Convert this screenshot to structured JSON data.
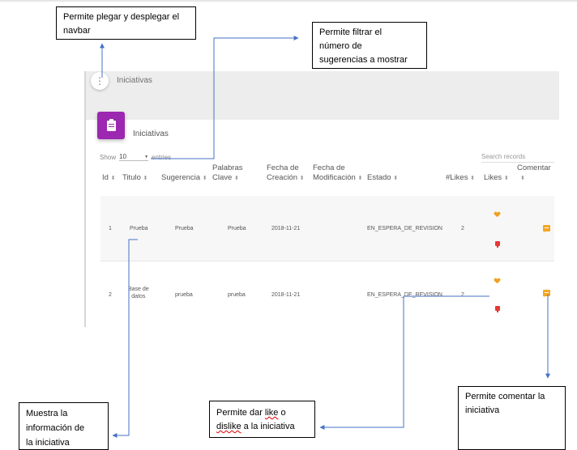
{
  "app": {
    "navbar": {
      "title": "Iniciativas",
      "toggle_glyph": "⋮"
    },
    "card": {
      "title": "Iniciativas",
      "show_label": "Show",
      "entries_value": "10",
      "entries_label": "entries",
      "search_placeholder": "Search records"
    },
    "table": {
      "headers": [
        {
          "line1": "Id",
          "line2": ""
        },
        {
          "line1": "Titulo",
          "line2": ""
        },
        {
          "line1": "Sugerencia",
          "line2": ""
        },
        {
          "line1": "Palabras",
          "line2": "Clave"
        },
        {
          "line1": "Fecha de",
          "line2": "Creación"
        },
        {
          "line1": "Fecha de",
          "line2": "Modificación"
        },
        {
          "line1": "Estado",
          "line2": ""
        },
        {
          "line1": "#Likes",
          "line2": ""
        },
        {
          "line1": "Likes",
          "line2": ""
        },
        {
          "line1": "Comentar",
          "line2": ""
        }
      ],
      "sort_glyph": "⬍",
      "rows": [
        {
          "id": "1",
          "titulo_l1": "Prueba",
          "titulo_l2": "",
          "sugerencia": "Prueba",
          "palabras": "Prueba",
          "fecha_creacion": "2018-11-21",
          "fecha_mod": "",
          "estado": "EN_ESPERA_DE_REVISION",
          "likes_count": "2"
        },
        {
          "id": "2",
          "titulo_l1": "Base de",
          "titulo_l2": "datos",
          "sugerencia": "prueba",
          "palabras": "prueba",
          "fecha_creacion": "2018-11-21",
          "fecha_mod": "",
          "estado": "EN_ESPERA_DE_REVISION",
          "likes_count": "2"
        }
      ]
    },
    "icons": [
      "clipboard-icon",
      "heart-icon",
      "dislike-icon",
      "comment-icon",
      "more-vert-icon"
    ],
    "colors": {
      "card_icon": "#9c27b0",
      "like": "#f0a020",
      "dislike": "#e53935",
      "comment": "#f5a623",
      "arrow": "#4472c4"
    }
  },
  "annotations": {
    "navbar": "Permite plegar y desplegar el navbar",
    "filter": {
      "line1": "Permite filtrar el",
      "line2": "número de",
      "line3": "sugerencias a mostrar"
    },
    "info": {
      "line1": "Muestra la",
      "line2": "información de",
      "line3": "la iniciativa"
    },
    "like": {
      "line1_a": "Permite dar ",
      "line1_b": "like",
      "line1_c": " o",
      "line2_a": "dislike",
      "line2_b": " a la iniciativa"
    },
    "comment": "Permite comentar la iniciativa"
  }
}
